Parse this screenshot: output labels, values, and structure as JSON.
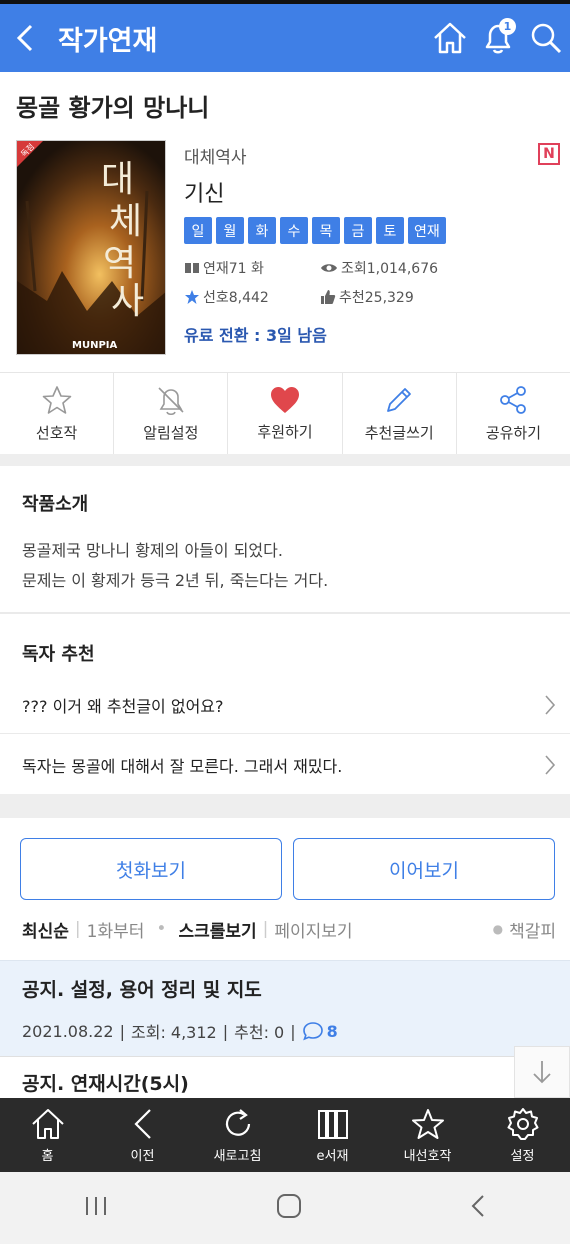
{
  "header": {
    "title": "작가연재",
    "bell_count": "1"
  },
  "work": {
    "title": "몽골 황가의 망나니",
    "genre": "대체역사",
    "author": "기신",
    "new_badge": "N",
    "cover": {
      "badge": "독점",
      "title_chars": [
        "대",
        "체",
        "역",
        "사"
      ],
      "publisher": "MUNPIA"
    },
    "days": [
      "일",
      "월",
      "화",
      "수",
      "목",
      "금",
      "토",
      "연재"
    ],
    "episodes": "연재71 화",
    "views": "조회1,014,676",
    "favorites": "선호8,442",
    "recommends": "추천25,329",
    "paid_notice": "유료 전환 : 3일 남음"
  },
  "actions": [
    {
      "label": "선호작",
      "icon": "star-outline-icon"
    },
    {
      "label": "알림설정",
      "icon": "bell-off-icon"
    },
    {
      "label": "후원하기",
      "icon": "heart-icon"
    },
    {
      "label": "추천글쓰기",
      "icon": "pencil-icon"
    },
    {
      "label": "공유하기",
      "icon": "share-icon"
    }
  ],
  "intro": {
    "title": "작품소개",
    "lines": [
      "몽골제국 망나니 황제의 아들이 되었다.",
      "문제는 이 황제가 등극 2년 뒤, 죽는다는 거다."
    ]
  },
  "reader_rec": {
    "title": "독자 추천",
    "items": [
      "??? 이거 왜 추천글이 없어요?",
      "독자는 몽골에 대해서 잘 모른다. 그래서 재밌다."
    ]
  },
  "buttons": {
    "first": "첫화보기",
    "continue": "이어보기"
  },
  "sort": {
    "latest": "최신순",
    "from_first": "1화부터",
    "scroll_view": "스크롤보기",
    "page_view": "페이지보기",
    "bookmark": "책갈피"
  },
  "episodes": [
    {
      "title": "공지. 설정, 용어 정리 및 지도",
      "date": "2021.08.22",
      "views": "조회: 4,312",
      "recs": "추천: 0",
      "comments": "8"
    },
    {
      "title": "공지. 연재시간(5시)"
    }
  ],
  "bottom_nav": [
    {
      "label": "홈",
      "icon": "home-icon"
    },
    {
      "label": "이전",
      "icon": "back-icon"
    },
    {
      "label": "새로고침",
      "icon": "refresh-icon"
    },
    {
      "label": "e서재",
      "icon": "library-icon"
    },
    {
      "label": "내선호작",
      "icon": "star-icon"
    },
    {
      "label": "설정",
      "icon": "gear-icon"
    }
  ],
  "colors": {
    "accent": "#3f7fe6",
    "heart": "#e0474c",
    "nav_bg": "#2b2b2b"
  }
}
